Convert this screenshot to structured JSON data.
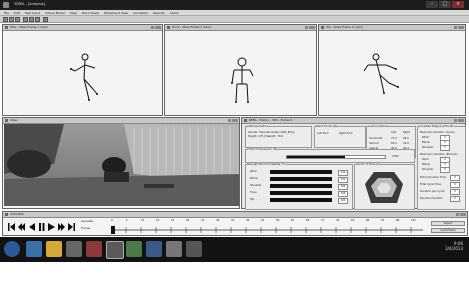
{
  "window": {
    "title": "3DMA - [Analysis]"
  },
  "menu": [
    "File",
    "Edit",
    "Task Input",
    "Virtual Model",
    "View",
    "Work Views",
    "Movement View",
    "Animation",
    "Reports",
    "About"
  ],
  "panes": {
    "side": {
      "title": "Side - Video Frame 1 (cam)"
    },
    "front": {
      "title": "Front - Video Frame 1 (cam)"
    },
    "top": {
      "title": "Top - Video Frame 1 (cam)"
    },
    "video": {
      "title": "Video"
    },
    "data": {
      "title": "REBA - History - 3DS - Frame 0"
    }
  },
  "data_panel": {
    "anthropometric_label": "Anthropometric",
    "anthropometric_text": "Gender: Male  Percentile: Data Entry",
    "anthropometric_text2": "Height: 175.0  Weight: 70.0",
    "hand_forces_label": "Hand Forces (N)",
    "hand_forces_left": "Left 10.0",
    "hand_forces_right": "Right 10.0",
    "l5s1_label": "L5/S1 Compression (N)",
    "l5s1_value": "2780",
    "strength_label": "Strength Percent Capable (%)",
    "strength_rows": [
      {
        "name": "Wrist",
        "value": "100"
      },
      {
        "name": "Elbow",
        "value": "100"
      },
      {
        "name": "Shoulder",
        "value": "100"
      },
      {
        "name": "Torso",
        "value": "100"
      },
      {
        "name": "Hip",
        "value": "100"
      }
    ],
    "cof_label": "Center of Pressure",
    "load_label": "Load Locations",
    "load_cols": [
      "Left",
      "Right"
    ],
    "load_rows": [
      {
        "name": "Horizontal",
        "left": "71.5",
        "right": "28.0"
      },
      {
        "name": "Vertical",
        "left": "62.0",
        "right": "32.0"
      },
      {
        "name": "Lateral",
        "left": "45.8",
        "right": "30.4"
      }
    ],
    "fatigue_label": "Localized Fatigue (25% Str)",
    "fatigue_left_label": "Maximum Duration (Cycle)",
    "fatigue_rows_a": [
      {
        "name": "Wrist",
        "value": "0"
      },
      {
        "name": "Elbow",
        "value": "0"
      },
      {
        "name": "Shoulder",
        "value": "0"
      }
    ],
    "fatigue_right_label": "Maximum Duration (Percent)",
    "fatigue_rows_b": [
      {
        "name": "Wrist",
        "value": "0"
      },
      {
        "name": "Elbow",
        "value": "0"
      },
      {
        "name": "Shoulder",
        "value": "0"
      }
    ],
    "fatigue_extra": [
      {
        "name": "Extra Duration Time",
        "value": "0"
      },
      {
        "name": "Total Cycle Time",
        "value": "0"
      },
      {
        "name": "Duration per Cycle",
        "value": "0"
      },
      {
        "name": "Exertion Duration",
        "value": "0"
      }
    ]
  },
  "animation": {
    "title": "Animation",
    "row1_label": "Generate",
    "row2_label": "Frames",
    "ticks": [
      "0",
      "5",
      "10",
      "16",
      "21",
      "26",
      "31",
      "36",
      "41",
      "46",
      "51",
      "56",
      "61",
      "66",
      "71",
      "76",
      "81",
      "86",
      "91",
      "96",
      "101"
    ],
    "btn1": "Import",
    "btn2": "Load Frame"
  },
  "taskbar": {
    "time": "9:06",
    "date": "3/4/2013"
  },
  "colors": {
    "bg": "#ffffff",
    "chrome": "#1d1d1d",
    "cop_fill": "#3a3a3a"
  }
}
